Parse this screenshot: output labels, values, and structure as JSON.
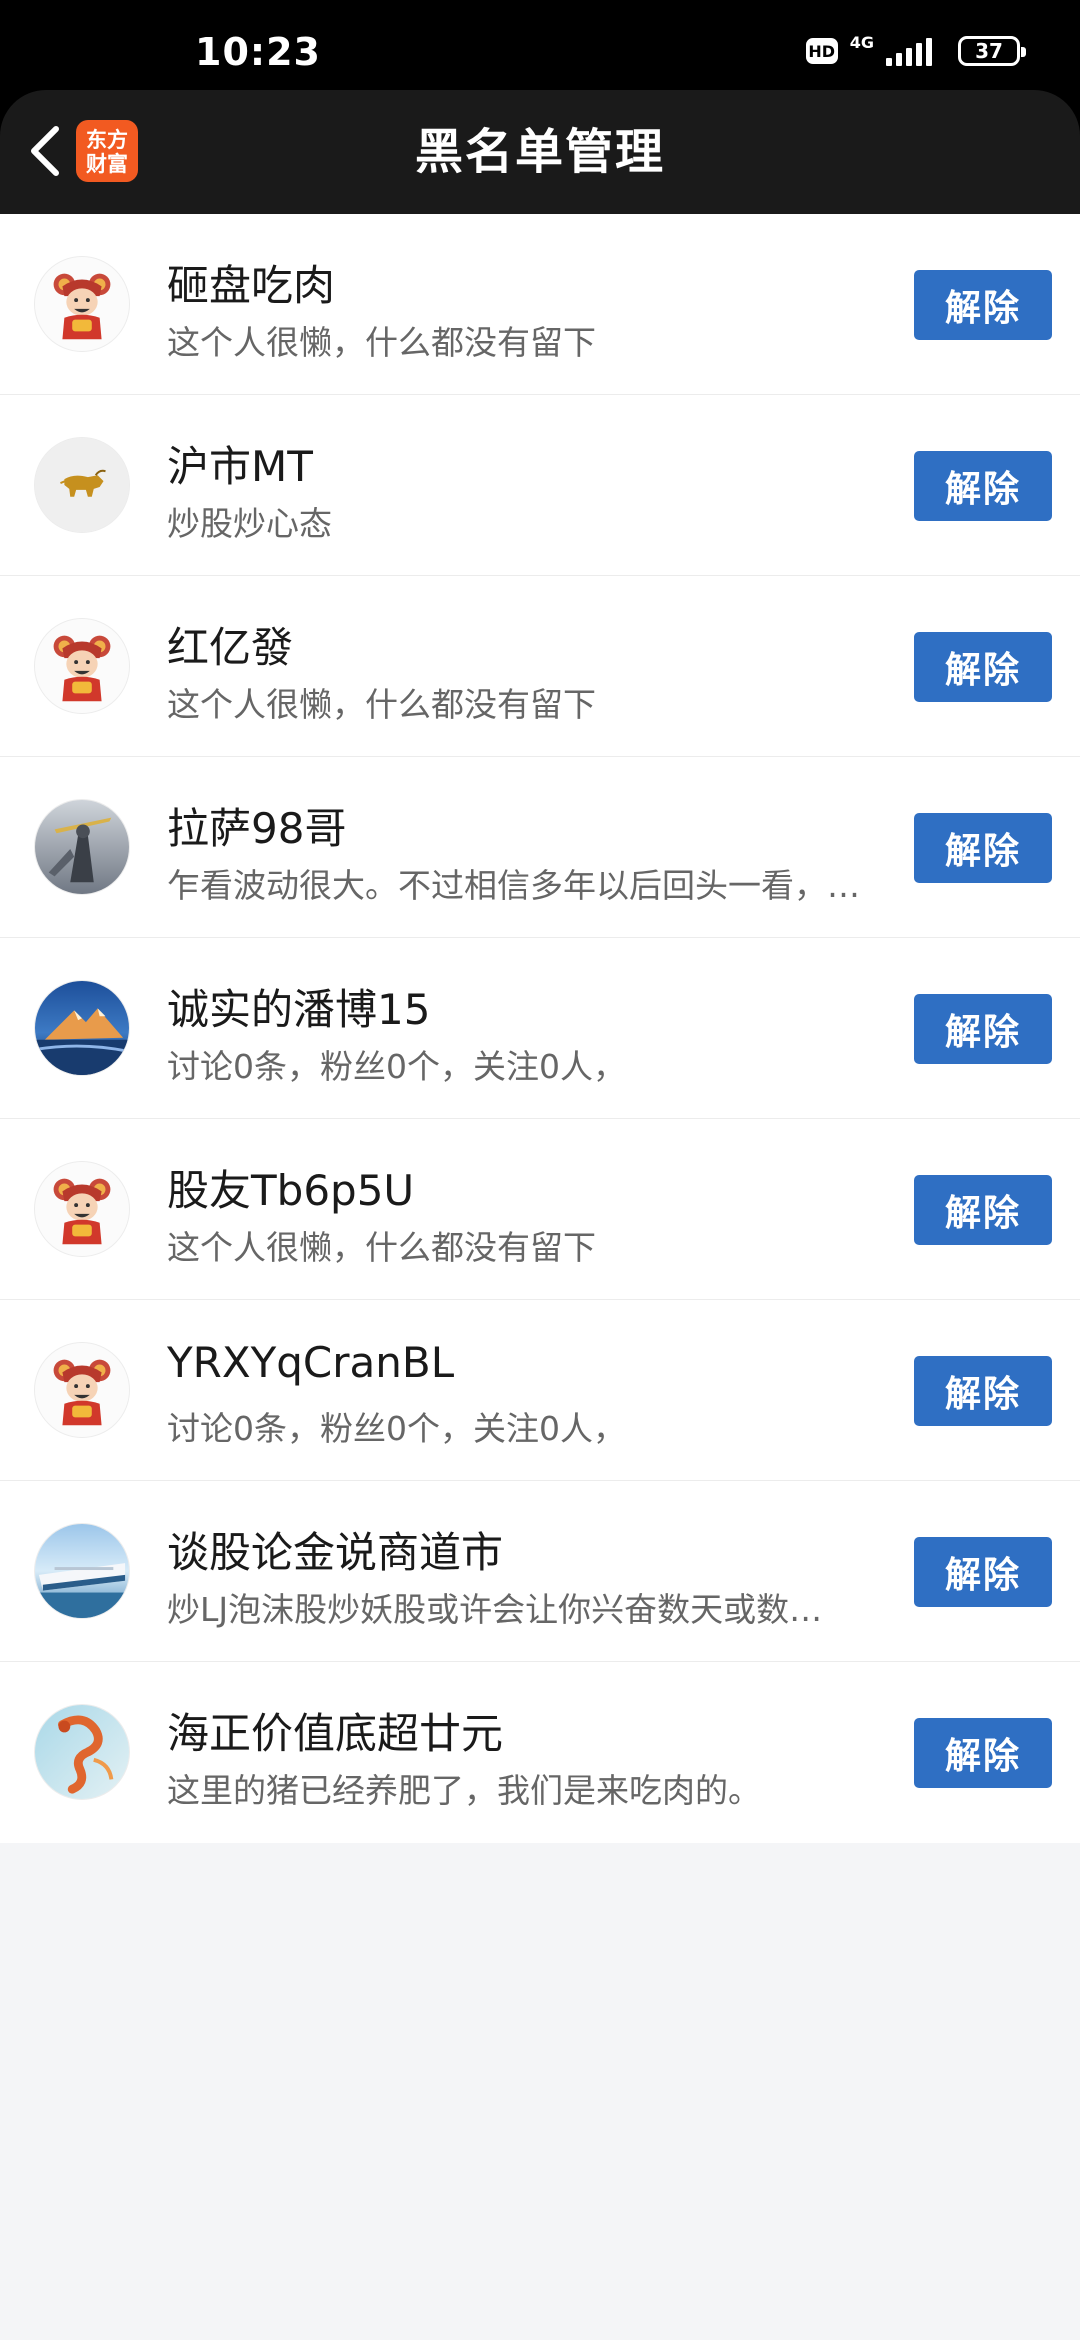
{
  "status_bar": {
    "time": "10:23",
    "hd": "HD",
    "network": "4G",
    "battery": "37"
  },
  "header": {
    "title": "黑名单管理",
    "logo_line1": "东方",
    "logo_line2": "财富",
    "accent_color": "#f25a21"
  },
  "blacklist": {
    "button_color": "#2f6fc3",
    "items": [
      {
        "name": "砸盘吃肉",
        "desc": "这个人很懒，什么都没有留下",
        "avatar": "mascot",
        "button": "解除"
      },
      {
        "name": "沪市MT",
        "desc": "炒股炒心态",
        "avatar": "bull",
        "button": "解除"
      },
      {
        "name": "红亿發",
        "desc": "这个人很懒，什么都没有留下",
        "avatar": "mascot",
        "button": "解除"
      },
      {
        "name": "拉萨98哥",
        "desc": "乍看波动很大。不过相信多年以后回头一看，…",
        "avatar": "warrior",
        "button": "解除"
      },
      {
        "name": "诚实的潘博15",
        "desc": "讨论0条，粉丝0个，关注0人，",
        "avatar": "mountain",
        "button": "解除"
      },
      {
        "name": "股友Tb6p5U",
        "desc": "这个人很懒，什么都没有留下",
        "avatar": "mascot",
        "button": "解除"
      },
      {
        "name": "YRXYqCranBL",
        "desc": "讨论0条，粉丝0个，关注0人，",
        "avatar": "mascot",
        "button": "解除"
      },
      {
        "name": "谈股论金说商道市",
        "desc": "炒LJ泡沫股炒妖股或许会让你兴奋数天或数…",
        "avatar": "ship",
        "button": "解除"
      },
      {
        "name": "海正价值底超廿元",
        "desc": "这里的猪已经养肥了，我们是来吃肉的。",
        "avatar": "dragon",
        "button": "解除"
      }
    ]
  }
}
